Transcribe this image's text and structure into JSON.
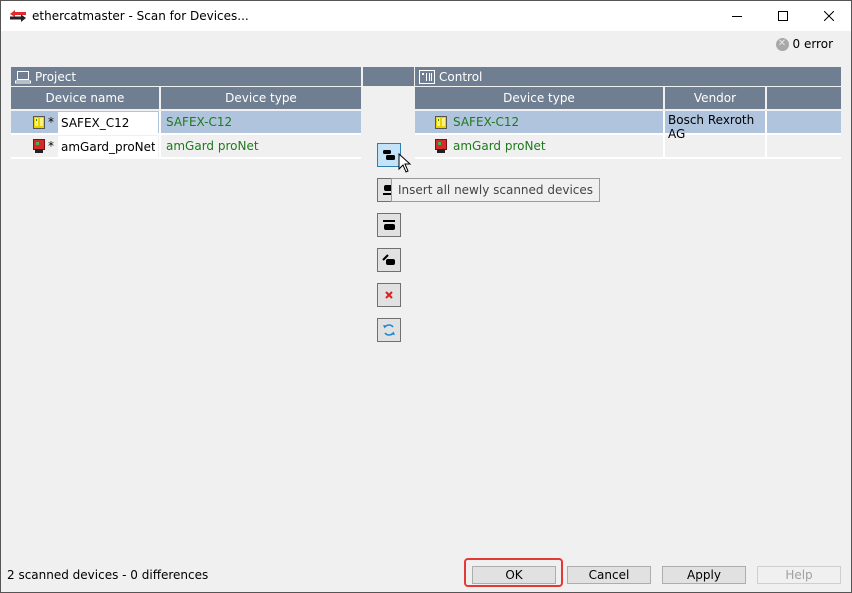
{
  "window": {
    "title": "ethercatmaster - Scan for Devices...",
    "app_icon": "ethercat-arrows-icon",
    "controls": {
      "minimize": "minimize-icon",
      "maximize": "maximize-icon",
      "close": "close-icon"
    }
  },
  "error_status": {
    "icon": "error-circle-icon",
    "label": "0 error"
  },
  "project": {
    "title": "Project",
    "icon": "computer-icon",
    "columns": [
      "Device name",
      "Device type"
    ],
    "rows": [
      {
        "icon": "yellow-device-icon",
        "modified": "*",
        "name": "SAFEX_C12",
        "type": "SAFEX-C12",
        "selected": true
      },
      {
        "icon": "red-device-icon",
        "modified": "*",
        "name": "amGard_proNet",
        "type": "amGard proNet",
        "selected": false
      }
    ]
  },
  "control": {
    "title": "Control",
    "icon": "control-cabinet-icon",
    "columns": [
      "Device type",
      "Vendor",
      ""
    ],
    "rows": [
      {
        "icon": "yellow-device-icon",
        "type": "SAFEX-C12",
        "vendor": "Bosch Rexroth AG",
        "selected": true
      },
      {
        "icon": "red-device-icon",
        "type": "amGard proNet",
        "vendor": "",
        "selected": false
      }
    ]
  },
  "side_buttons": [
    {
      "name": "insert-all-new-button",
      "icon": "insert-all-icon",
      "hover": true
    },
    {
      "name": "insert-selected-button",
      "icon": "insert-selected-icon"
    },
    {
      "name": "replace-button",
      "icon": "replace-icon"
    },
    {
      "name": "move-button",
      "icon": "move-icon"
    },
    {
      "name": "delete-button",
      "icon": "red-x-icon"
    },
    {
      "name": "rescan-button",
      "icon": "refresh-icon"
    }
  ],
  "tooltip": "Insert all newly scanned devices",
  "footer": {
    "status": "2 scanned devices - 0 differences",
    "buttons": {
      "ok": "OK",
      "cancel": "Cancel",
      "apply": "Apply",
      "help": "Help"
    },
    "highlight_color": "#e53935"
  },
  "colors": {
    "header_bg": "#6f7f91",
    "selected_row": "#b0c4de",
    "device_type_text": "#1d7a1d"
  }
}
